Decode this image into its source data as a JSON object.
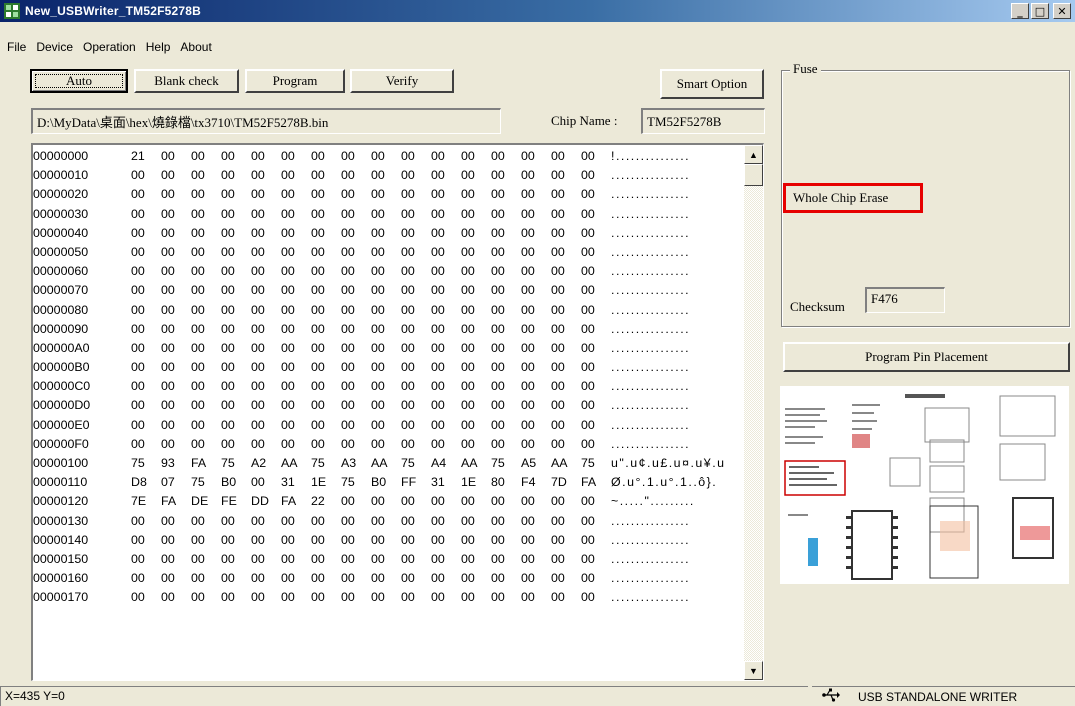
{
  "window": {
    "title": "New_USBWriter_TM52F5278B"
  },
  "menu": {
    "items": [
      "File",
      "Device",
      "Operation",
      "Help",
      "About"
    ]
  },
  "toolbar": {
    "auto_label": "Auto",
    "blank_check_label": "Blank check",
    "program_label": "Program",
    "verify_label": "Verify",
    "smart_option_label": "Smart Option"
  },
  "file": {
    "path": "D:\\MyData\\桌面\\hex\\燒錄檔\\tx3710\\TM52F5278B.bin"
  },
  "chip": {
    "label": "Chip Name :",
    "value": "TM52F5278B"
  },
  "hex": {
    "rows": [
      {
        "addr": "00000000",
        "bytes": [
          "21",
          "00",
          "00",
          "00",
          "00",
          "00",
          "00",
          "00",
          "00",
          "00",
          "00",
          "00",
          "00",
          "00",
          "00",
          "00"
        ],
        "ascii": "!..............."
      },
      {
        "addr": "00000010",
        "bytes": [
          "00",
          "00",
          "00",
          "00",
          "00",
          "00",
          "00",
          "00",
          "00",
          "00",
          "00",
          "00",
          "00",
          "00",
          "00",
          "00"
        ],
        "ascii": "................"
      },
      {
        "addr": "00000020",
        "bytes": [
          "00",
          "00",
          "00",
          "00",
          "00",
          "00",
          "00",
          "00",
          "00",
          "00",
          "00",
          "00",
          "00",
          "00",
          "00",
          "00"
        ],
        "ascii": "................"
      },
      {
        "addr": "00000030",
        "bytes": [
          "00",
          "00",
          "00",
          "00",
          "00",
          "00",
          "00",
          "00",
          "00",
          "00",
          "00",
          "00",
          "00",
          "00",
          "00",
          "00"
        ],
        "ascii": "................"
      },
      {
        "addr": "00000040",
        "bytes": [
          "00",
          "00",
          "00",
          "00",
          "00",
          "00",
          "00",
          "00",
          "00",
          "00",
          "00",
          "00",
          "00",
          "00",
          "00",
          "00"
        ],
        "ascii": "................"
      },
      {
        "addr": "00000050",
        "bytes": [
          "00",
          "00",
          "00",
          "00",
          "00",
          "00",
          "00",
          "00",
          "00",
          "00",
          "00",
          "00",
          "00",
          "00",
          "00",
          "00"
        ],
        "ascii": "................"
      },
      {
        "addr": "00000060",
        "bytes": [
          "00",
          "00",
          "00",
          "00",
          "00",
          "00",
          "00",
          "00",
          "00",
          "00",
          "00",
          "00",
          "00",
          "00",
          "00",
          "00"
        ],
        "ascii": "................"
      },
      {
        "addr": "00000070",
        "bytes": [
          "00",
          "00",
          "00",
          "00",
          "00",
          "00",
          "00",
          "00",
          "00",
          "00",
          "00",
          "00",
          "00",
          "00",
          "00",
          "00"
        ],
        "ascii": "................"
      },
      {
        "addr": "00000080",
        "bytes": [
          "00",
          "00",
          "00",
          "00",
          "00",
          "00",
          "00",
          "00",
          "00",
          "00",
          "00",
          "00",
          "00",
          "00",
          "00",
          "00"
        ],
        "ascii": "................"
      },
      {
        "addr": "00000090",
        "bytes": [
          "00",
          "00",
          "00",
          "00",
          "00",
          "00",
          "00",
          "00",
          "00",
          "00",
          "00",
          "00",
          "00",
          "00",
          "00",
          "00"
        ],
        "ascii": "................"
      },
      {
        "addr": "000000A0",
        "bytes": [
          "00",
          "00",
          "00",
          "00",
          "00",
          "00",
          "00",
          "00",
          "00",
          "00",
          "00",
          "00",
          "00",
          "00",
          "00",
          "00"
        ],
        "ascii": "................"
      },
      {
        "addr": "000000B0",
        "bytes": [
          "00",
          "00",
          "00",
          "00",
          "00",
          "00",
          "00",
          "00",
          "00",
          "00",
          "00",
          "00",
          "00",
          "00",
          "00",
          "00"
        ],
        "ascii": "................"
      },
      {
        "addr": "000000C0",
        "bytes": [
          "00",
          "00",
          "00",
          "00",
          "00",
          "00",
          "00",
          "00",
          "00",
          "00",
          "00",
          "00",
          "00",
          "00",
          "00",
          "00"
        ],
        "ascii": "................"
      },
      {
        "addr": "000000D0",
        "bytes": [
          "00",
          "00",
          "00",
          "00",
          "00",
          "00",
          "00",
          "00",
          "00",
          "00",
          "00",
          "00",
          "00",
          "00",
          "00",
          "00"
        ],
        "ascii": "................"
      },
      {
        "addr": "000000E0",
        "bytes": [
          "00",
          "00",
          "00",
          "00",
          "00",
          "00",
          "00",
          "00",
          "00",
          "00",
          "00",
          "00",
          "00",
          "00",
          "00",
          "00"
        ],
        "ascii": "................"
      },
      {
        "addr": "000000F0",
        "bytes": [
          "00",
          "00",
          "00",
          "00",
          "00",
          "00",
          "00",
          "00",
          "00",
          "00",
          "00",
          "00",
          "00",
          "00",
          "00",
          "00"
        ],
        "ascii": "................"
      },
      {
        "addr": "00000100",
        "bytes": [
          "75",
          "93",
          "FA",
          "75",
          "A2",
          "AA",
          "75",
          "A3",
          "AA",
          "75",
          "A4",
          "AA",
          "75",
          "A5",
          "AA",
          "75"
        ],
        "ascii": "u\".u¢.u£.u¤.u¥.u"
      },
      {
        "addr": "00000110",
        "bytes": [
          "D8",
          "07",
          "75",
          "B0",
          "00",
          "31",
          "1E",
          "75",
          "B0",
          "FF",
          "31",
          "1E",
          "80",
          "F4",
          "7D",
          "FA"
        ],
        "ascii": "Ø.u°.1.u°.1..ô}."
      },
      {
        "addr": "00000120",
        "bytes": [
          "7E",
          "FA",
          "DE",
          "FE",
          "DD",
          "FA",
          "22",
          "00",
          "00",
          "00",
          "00",
          "00",
          "00",
          "00",
          "00",
          "00"
        ],
        "ascii": "~.....\"........."
      },
      {
        "addr": "00000130",
        "bytes": [
          "00",
          "00",
          "00",
          "00",
          "00",
          "00",
          "00",
          "00",
          "00",
          "00",
          "00",
          "00",
          "00",
          "00",
          "00",
          "00"
        ],
        "ascii": "................"
      },
      {
        "addr": "00000140",
        "bytes": [
          "00",
          "00",
          "00",
          "00",
          "00",
          "00",
          "00",
          "00",
          "00",
          "00",
          "00",
          "00",
          "00",
          "00",
          "00",
          "00"
        ],
        "ascii": "................"
      },
      {
        "addr": "00000150",
        "bytes": [
          "00",
          "00",
          "00",
          "00",
          "00",
          "00",
          "00",
          "00",
          "00",
          "00",
          "00",
          "00",
          "00",
          "00",
          "00",
          "00"
        ],
        "ascii": "................"
      },
      {
        "addr": "00000160",
        "bytes": [
          "00",
          "00",
          "00",
          "00",
          "00",
          "00",
          "00",
          "00",
          "00",
          "00",
          "00",
          "00",
          "00",
          "00",
          "00",
          "00"
        ],
        "ascii": "................"
      },
      {
        "addr": "00000170",
        "bytes": [
          "00",
          "00",
          "00",
          "00",
          "00",
          "00",
          "00",
          "00",
          "00",
          "00",
          "00",
          "00",
          "00",
          "00",
          "00",
          "00"
        ],
        "ascii": "................"
      }
    ]
  },
  "fuse": {
    "title": "Fuse",
    "whole_chip_erase": "Whole Chip Erase",
    "highlight_color": "#e60000",
    "checksum_label": "Checksum",
    "checksum_value": "F476"
  },
  "pin_placement": {
    "button_label": "Program Pin Placement"
  },
  "status": {
    "coords": "X=435 Y=0",
    "writer": "USB STANDALONE WRITER",
    "icon": "usb-icon"
  }
}
